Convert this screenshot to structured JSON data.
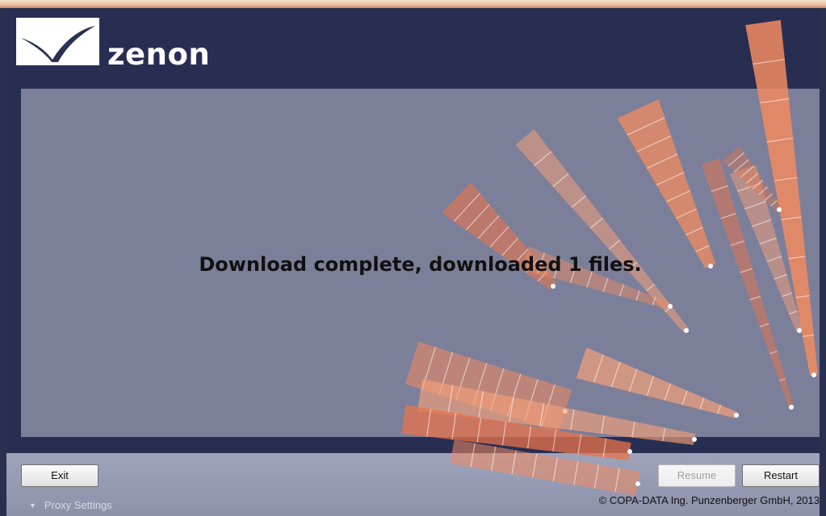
{
  "app": {
    "name": "zenon",
    "logo_icon": "zenon-swoosh-logo-icon"
  },
  "main": {
    "status_message": "Download complete, downloaded 1 files."
  },
  "buttons": {
    "exit_label": "Exit",
    "resume_label": "Resume",
    "restart_label": "Restart"
  },
  "footer": {
    "proxy_settings_label": "Proxy Settings",
    "proxy_settings_icon": "chevron-down-icon",
    "copyright": "© COPA-DATA Ing. Punzenberger GmbH, 2013"
  },
  "colors": {
    "frame": "#282e52",
    "content_background": "#7c7f99",
    "accent_orange": "#f08a62",
    "footer": "#9599b0"
  }
}
